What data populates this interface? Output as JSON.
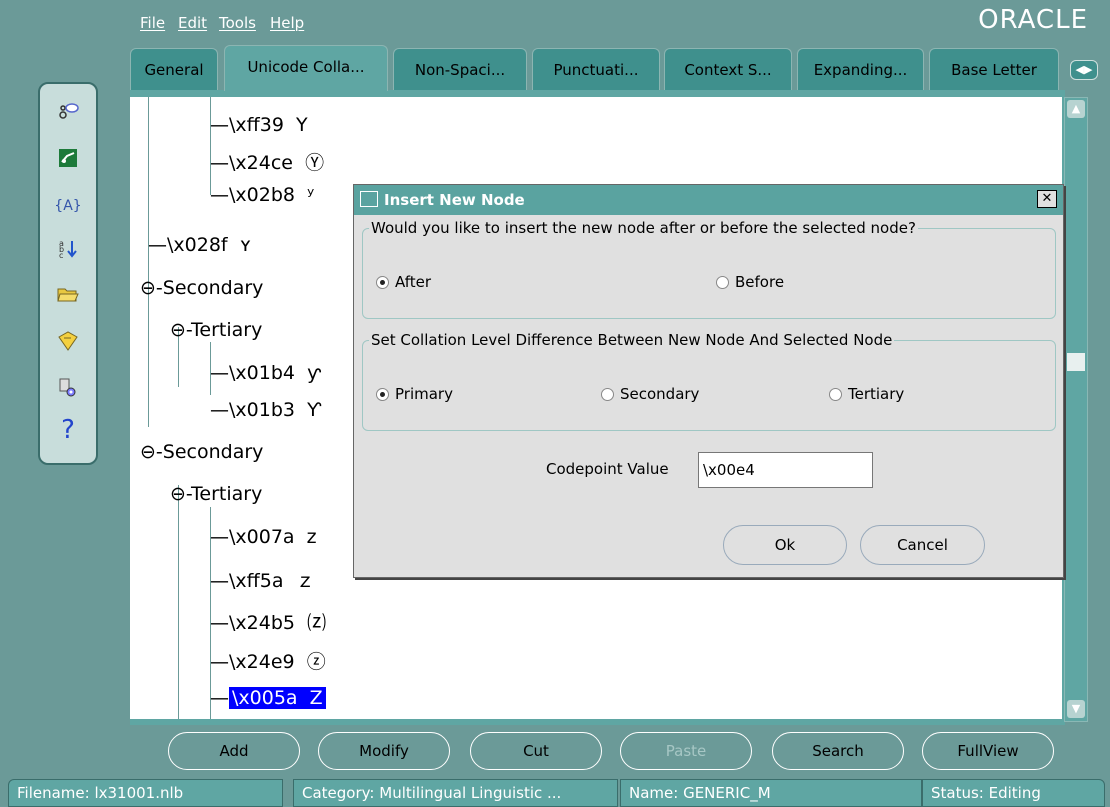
{
  "menu": [
    "File",
    "Edit",
    "Tools",
    "Help"
  ],
  "logo": "ORACLE",
  "tabs": [
    "General",
    "Unicode Colla...",
    "Non-Spaci...",
    "Punctuati...",
    "Context S...",
    "Expanding...",
    "Base Letter"
  ],
  "tree": {
    "nodes": [
      {
        "code": "\\xff39",
        "glyph": "Y"
      },
      {
        "code": "\\x24ce",
        "glyph": "Ⓨ"
      },
      {
        "code": "\\x02b8",
        "glyph": "ʸ"
      },
      {
        "code": "\\x028f",
        "glyph": "ʏ"
      },
      {
        "code": "Secondary"
      },
      {
        "code": "Tertiary"
      },
      {
        "code": "\\x01b4",
        "glyph": "ƴ"
      },
      {
        "code": "\\x01b3",
        "glyph": "Ƴ"
      },
      {
        "code": "Secondary"
      },
      {
        "code": "Tertiary"
      },
      {
        "code": "\\x007a",
        "glyph": "z"
      },
      {
        "code": "\\xff5a",
        "glyph": "ｚ"
      },
      {
        "code": "\\x24b5",
        "glyph": "⒵"
      },
      {
        "code": "\\x24e9",
        "glyph": "ⓩ"
      },
      {
        "code": "\\x005a",
        "glyph": "Z"
      }
    ]
  },
  "buttons": [
    "Add",
    "Modify",
    "Cut",
    "Paste",
    "Search",
    "FullView"
  ],
  "status": {
    "filename": "Filename: lx31001.nlb",
    "category": "Category: Multilingual Linguistic ...",
    "name": "Name: GENERIC_M",
    "state": "Status: Editing"
  },
  "dialog": {
    "title": "Insert New Node",
    "position_legend": "Would you like to insert the new node after or before the selected node?",
    "position_options": [
      "After",
      "Before"
    ],
    "position_selected": "After",
    "level_legend": "Set Collation Level Difference Between New Node And Selected Node",
    "level_options": [
      "Primary",
      "Secondary",
      "Tertiary"
    ],
    "level_selected": "Primary",
    "codepoint_label": "Codepoint Value",
    "codepoint_value": "\\x00e4",
    "ok": "Ok",
    "cancel": "Cancel"
  },
  "icons": [
    "node-tree-icon",
    "diagram-icon",
    "variable-icon",
    "sort-icon",
    "open-folder-icon",
    "save-icon",
    "tools-settings-icon",
    "help-icon"
  ]
}
